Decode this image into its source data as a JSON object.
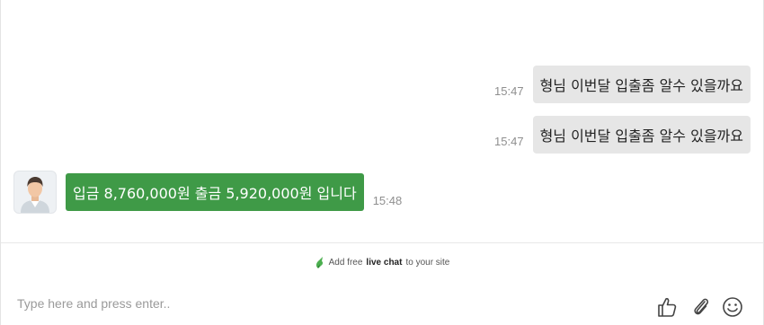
{
  "messages": {
    "outgoing": [
      {
        "time": "15:47",
        "text": "형님 이번달 입출좀 알수 있을까요"
      },
      {
        "time": "15:47",
        "text": "형님 이번달 입출좀 알수 있을까요"
      }
    ],
    "incoming": [
      {
        "time": "15:48",
        "text": "입금 8,760,000원 출금 5,920,000원 입니다"
      }
    ]
  },
  "promo": {
    "prefix": "Add free",
    "link": "live chat",
    "suffix": "to your site"
  },
  "composer": {
    "placeholder": "Type here and press enter.."
  },
  "icons": {
    "like": "thumbs-up-icon",
    "attach": "paperclip-icon",
    "emoji": "smiley-icon",
    "promo": "livechat-logo-icon"
  },
  "colors": {
    "incoming_bubble": "#3f9a47",
    "outgoing_bubble": "#e6e6e6"
  }
}
